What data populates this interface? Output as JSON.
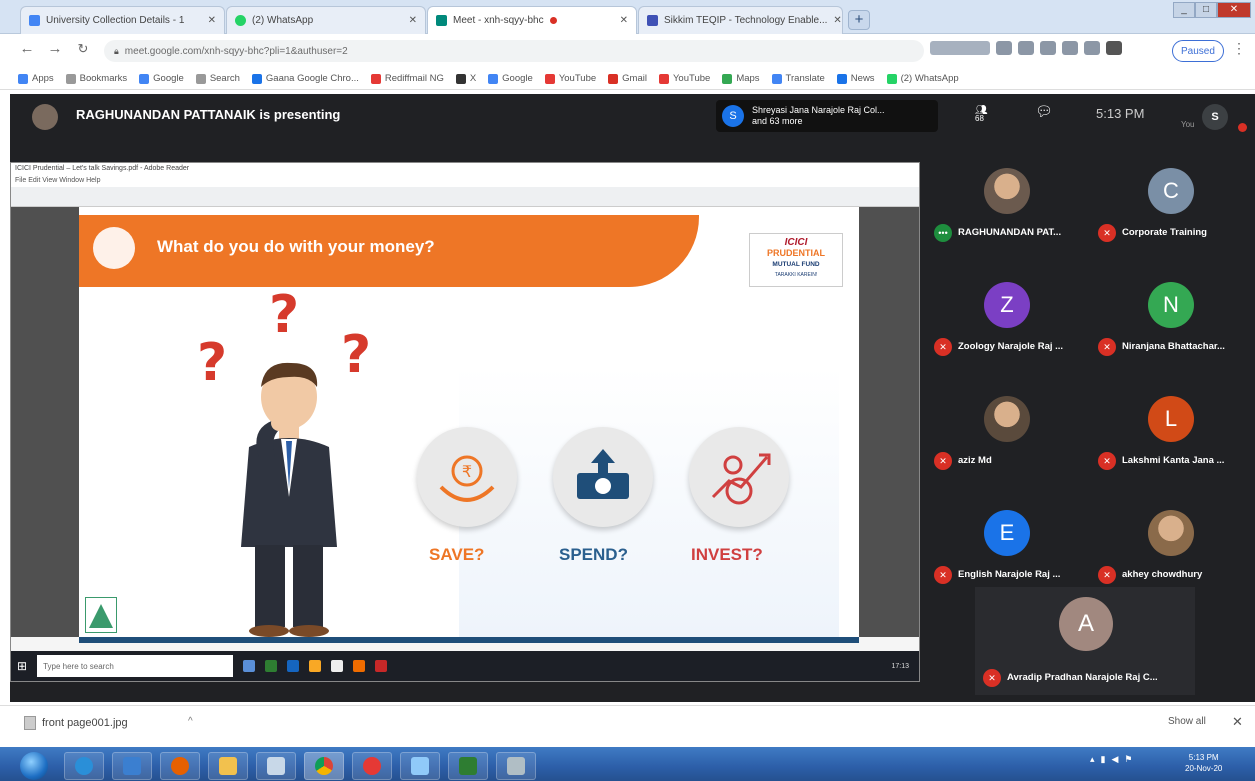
{
  "browser": {
    "tabs": [
      {
        "label": "University Collection Details - 1",
        "favicon_color": "#4285f4",
        "active": false
      },
      {
        "label": "(2) WhatsApp",
        "favicon_color": "#25d366",
        "active": false
      },
      {
        "label": "Meet - xnh-sqyy-bhc",
        "favicon_color": "#00897b",
        "active": true
      },
      {
        "label": "Sikkim TEQIP - Technology Enable...",
        "favicon_color": "#3f51b5",
        "active": false
      }
    ],
    "new_tab": "+",
    "url": "meet.google.com/xnh-sqyy-bhc?pli=1&authuser=2",
    "profile_status": "Paused",
    "menu": "⋮",
    "bookmarks": [
      {
        "label": "Apps",
        "color": "#4285f4"
      },
      {
        "label": "Bookmarks",
        "color": "#999999"
      },
      {
        "label": "Google",
        "color": "#4285f4"
      },
      {
        "label": "Search",
        "color": "#999999"
      },
      {
        "label": "Gaana Google Chro...",
        "color": "#1a73e8"
      },
      {
        "label": "Rediffmail NG",
        "color": "#e53935"
      },
      {
        "label": "X",
        "color": "#333333"
      },
      {
        "label": "Google",
        "color": "#4285f4"
      },
      {
        "label": "YouTube",
        "color": "#e53935"
      },
      {
        "label": "Gmail",
        "color": "#d93025"
      },
      {
        "label": "YouTube",
        "color": "#e53935"
      },
      {
        "label": "Maps",
        "color": "#34a853"
      },
      {
        "label": "Translate",
        "color": "#4285f4"
      },
      {
        "label": "News",
        "color": "#1a73e8"
      },
      {
        "label": "(2) WhatsApp",
        "color": "#25d366"
      }
    ]
  },
  "meet": {
    "presenting_text": "RAGHUNANDAN PATTANAIK is presenting",
    "attendees_initial": "S",
    "attendees_line1": "Shreyasi Jana Narajole Raj Col...",
    "attendees_line2": "and 63 more",
    "people_icon": "people-icon",
    "people_count": "68",
    "chat_icon": "chat-icon",
    "clock": "5:13 PM",
    "you_label": "You",
    "self_initial": "S",
    "participants": [
      {
        "name": "RAGHUNANDAN PAT...",
        "initial": "",
        "color": "#6b5a4e",
        "photo": true,
        "mic_on": true
      },
      {
        "name": "Corporate Training",
        "initial": "C",
        "color": "#7a8fa6",
        "photo": false,
        "mic_on": false
      },
      {
        "name": "Zoology Narajole Raj ...",
        "initial": "Z",
        "color": "#7b3fc4",
        "photo": false,
        "mic_on": false
      },
      {
        "name": "Niranjana Bhattachar...",
        "initial": "N",
        "color": "#34a853",
        "photo": false,
        "mic_on": false
      },
      {
        "name": "aziz Md",
        "initial": "",
        "color": "#5a4a3c",
        "photo": true,
        "mic_on": false
      },
      {
        "name": "Lakshmi Kanta Jana ...",
        "initial": "L",
        "color": "#d14a17",
        "photo": false,
        "mic_on": false
      },
      {
        "name": "English Narajole Raj ...",
        "initial": "E",
        "color": "#1a73e8",
        "photo": false,
        "mic_on": false
      },
      {
        "name": "akhey chowdhury",
        "initial": "",
        "color": "#8a6a4a",
        "photo": true,
        "mic_on": false
      }
    ],
    "big_tile": {
      "name": "Avradip Pradhan Narajole Raj C...",
      "initial": "A",
      "color": "#a1887f"
    }
  },
  "shared_screen": {
    "window_title": "ICICI Prudential – Let's talk Savings.pdf - Adobe Reader",
    "menu": "File  Edit  View  Window  Help",
    "slide": {
      "title": "What do you do with your money?",
      "logo_line1": "ICICI",
      "logo_line2": "PRUDENTIAL",
      "logo_line3": "MUTUAL FUND",
      "logo_line4": "TARAKKI KAREIN!",
      "question_mark": "?",
      "options": [
        "SAVE?",
        "SPEND?",
        "INVEST?"
      ]
    },
    "taskbar_search": "Type here to search",
    "taskbar_clock": "17:13"
  },
  "downloads": {
    "file": "front page001.jpg",
    "caret": "^",
    "show_all": "Show all",
    "close": "✕"
  },
  "windows_taskbar": {
    "clock_time": "5:13 PM",
    "clock_date": "20-Nov-20"
  }
}
